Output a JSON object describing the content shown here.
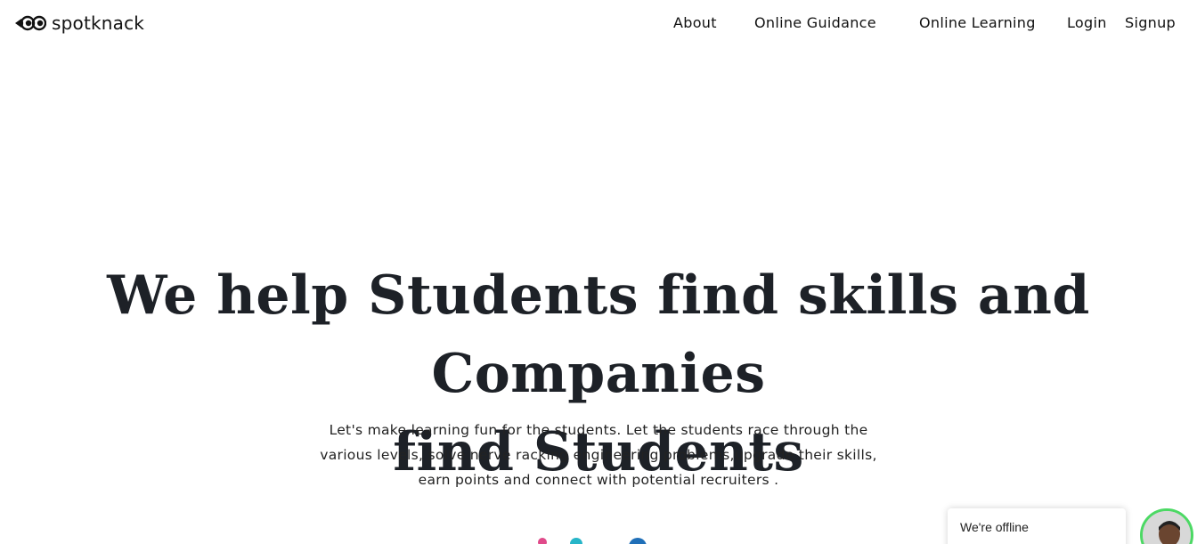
{
  "brand": {
    "name": "spotknack"
  },
  "nav": {
    "items": [
      {
        "label": "About"
      },
      {
        "label": "Online Guidance"
      },
      {
        "label": "Online Learning"
      },
      {
        "label": "Login"
      },
      {
        "label": "Signup"
      }
    ]
  },
  "hero": {
    "title_line1": "We help Students find skills and Companies",
    "title_line2": "find Students",
    "subtitle_line1": "Let's make learning fun for the students. Let the students race through the",
    "subtitle_line2": "various levels, solve nerve racking engineering problems,upgrade their skills,",
    "subtitle_line3": "earn points and connect with potential recruiters ."
  },
  "chat": {
    "status": "We're offline"
  },
  "colors": {
    "text": "#1d2127",
    "background": "#ffffff",
    "online_ring": "#4cd964"
  }
}
